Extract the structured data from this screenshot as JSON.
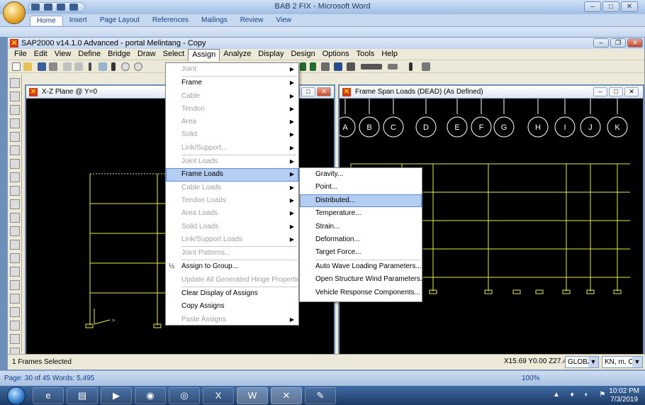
{
  "word": {
    "title": "BAB 2 FIX - Microsoft Word",
    "tabs": [
      "Home",
      "Insert",
      "Page Layout",
      "References",
      "Mailings",
      "Review",
      "View"
    ],
    "status": "Page: 30 of 45    Words: 5,495",
    "zoom": "100%"
  },
  "sap": {
    "title": "SAP2000 v14.1.0 Advanced  - portal Melintang - Copy",
    "menus": [
      "File",
      "Edit",
      "View",
      "Define",
      "Bridge",
      "Draw",
      "Select",
      "Assign",
      "Analyze",
      "Display",
      "Design",
      "Options",
      "Tools",
      "Help"
    ],
    "left_window_title": "X-Z Plane @ Y=0",
    "right_window_title": "Frame Span Loads (DEAD) (As Defined)",
    "grid_bubbles": [
      "A",
      "B",
      "C",
      "D",
      "E",
      "F",
      "G",
      "H",
      "I",
      "J",
      "K"
    ],
    "status_left": "1 Frames Selected",
    "coords": "X15.69  Y0.00  Z27.43",
    "coord_system": "GLOBAL",
    "units": "KN, m, C"
  },
  "assign_menu": {
    "items": [
      {
        "label": "Joint",
        "disabled": true,
        "submenu": true
      },
      {
        "label": "Frame",
        "disabled": false,
        "submenu": true
      },
      {
        "label": "Cable",
        "disabled": true,
        "submenu": true
      },
      {
        "label": "Tendon",
        "disabled": true,
        "submenu": true
      },
      {
        "label": "Area",
        "disabled": true,
        "submenu": true
      },
      {
        "label": "Solid",
        "disabled": true,
        "submenu": true
      },
      {
        "label": "Link/Support...",
        "disabled": true,
        "submenu": true
      },
      {
        "label": "Joint Loads",
        "disabled": true,
        "submenu": true
      },
      {
        "label": "Frame Loads",
        "disabled": false,
        "submenu": true,
        "highlighted": true
      },
      {
        "label": "Cable Loads",
        "disabled": true,
        "submenu": true
      },
      {
        "label": "Tendon Loads",
        "disabled": true,
        "submenu": true
      },
      {
        "label": "Area Loads",
        "disabled": true,
        "submenu": true
      },
      {
        "label": "Solid Loads",
        "disabled": true,
        "submenu": true
      },
      {
        "label": "Link/Support Loads",
        "disabled": true,
        "submenu": true
      },
      {
        "label": "Joint Patterns...",
        "disabled": true,
        "submenu": false
      },
      {
        "label": "Assign to Group...",
        "disabled": false,
        "submenu": false,
        "icon": "½"
      },
      {
        "label": "Update All Generated Hinge Properties",
        "disabled": true,
        "submenu": false
      },
      {
        "label": "Clear Display of Assigns",
        "disabled": false,
        "submenu": false
      },
      {
        "label": "Copy Assigns",
        "disabled": false,
        "submenu": false
      },
      {
        "label": "Paste Assigns",
        "disabled": true,
        "submenu": true
      }
    ]
  },
  "frame_loads_menu": {
    "items": [
      {
        "label": "Gravity..."
      },
      {
        "label": "Point..."
      },
      {
        "label": "Distributed...",
        "highlighted": true
      },
      {
        "label": "Temperature..."
      },
      {
        "label": "Strain..."
      },
      {
        "label": "Deformation..."
      },
      {
        "label": "Target Force..."
      },
      {
        "label": "Auto Wave Loading Parameters..."
      },
      {
        "label": "Open Structure Wind Parameters..."
      },
      {
        "label": "Vehicle Response Components..."
      }
    ]
  },
  "taskbar": {
    "time": "10:02 PM",
    "date": "7/3/2019"
  },
  "colors": {
    "frame_line": "#e8e84a",
    "canvas": "#000000",
    "menu_highlight": "#b4cdf0"
  }
}
